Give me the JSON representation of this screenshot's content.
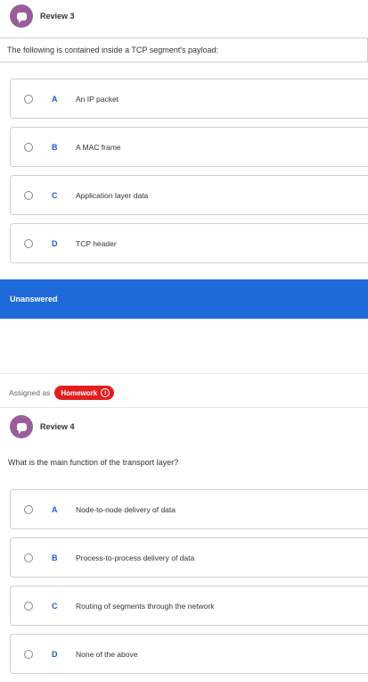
{
  "review3": {
    "title": "Review 3",
    "question": "The following is contained inside a TCP segment's payload:",
    "options": [
      {
        "letter": "A",
        "text": "An IP packet"
      },
      {
        "letter": "B",
        "text": "A MAC frame"
      },
      {
        "letter": "C",
        "text": "Application layer data"
      },
      {
        "letter": "D",
        "text": "TCP header"
      }
    ],
    "status": "Unanswered"
  },
  "assignment": {
    "label": "Assigned as",
    "badge": "Homework",
    "badge_icon": "info-icon"
  },
  "review4": {
    "title": "Review 4",
    "question": "What is the main function of the transport layer?",
    "options": [
      {
        "letter": "A",
        "text": "Node-to-node delivery of data"
      },
      {
        "letter": "B",
        "text": "Process-to-process delivery of data"
      },
      {
        "letter": "C",
        "text": "Routing of segments through the network"
      },
      {
        "letter": "D",
        "text": "None of the above"
      }
    ]
  },
  "colors": {
    "accent": "#1d6ad8",
    "letter": "#1a5cc8",
    "badge": "#e02020",
    "avatar": "#9a5c9a"
  }
}
